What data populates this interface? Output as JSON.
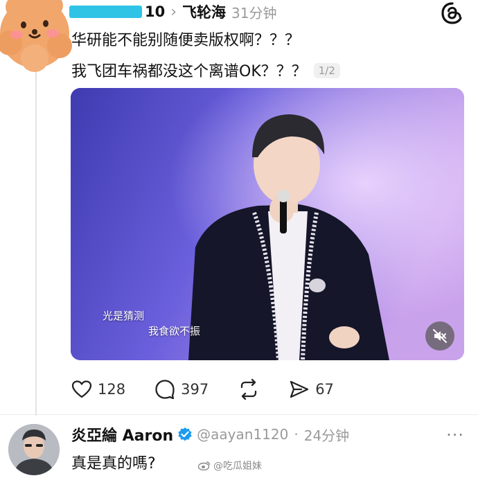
{
  "post": {
    "author_partial": "10",
    "breadcrumb_separator": "›",
    "author": "飞轮海",
    "time": "31分钟",
    "text_line1": "华研能不能别随便卖版权啊？？？",
    "text_line2": "我飞团车祸都没这个离谱OK？？？",
    "page_counter": "1/2",
    "media": {
      "subtitle_line1": "光是猜测",
      "subtitle_line2": "我食欲不振",
      "mute_icon": "speaker-muted-icon"
    },
    "actions": {
      "likes": "128",
      "replies": "397",
      "shares": "67"
    }
  },
  "reply": {
    "name": "炎亞綸 Aaron",
    "handle": "@aayan1120",
    "separator": "·",
    "time": "24分钟",
    "more": "···",
    "text": "真是真的嗎?"
  },
  "watermark": {
    "text": "@吃瓜姐妹"
  },
  "colors": {
    "redaction": "#2fc3e6",
    "verified": "#1d9bf0",
    "media_bg": "#5b52c9",
    "muted_text": "#9a9a9a"
  }
}
